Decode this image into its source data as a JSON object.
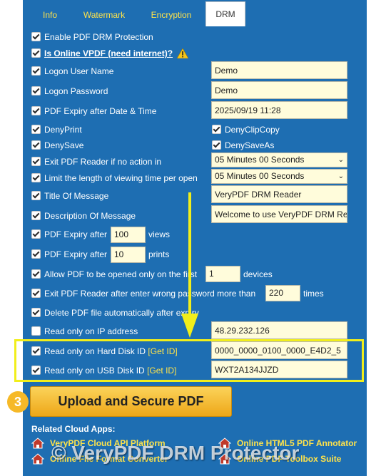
{
  "tabs": [
    {
      "label": "Info"
    },
    {
      "label": "Watermark"
    },
    {
      "label": "Encryption"
    },
    {
      "label": "DRM"
    }
  ],
  "rows": {
    "enable_drm": "Enable PDF DRM Protection",
    "online_vpdf": "Is Online VPDF (need internet)?",
    "logon_user": "Logon User Name",
    "logon_password": "Logon Password",
    "expiry_date": "PDF Expiry after Date & Time",
    "deny_print": "DenyPrint",
    "deny_clip": "DenyClipCopy",
    "deny_save": "DenySave",
    "deny_saveas": "DenySaveAs",
    "exit_no_action": "Exit PDF Reader if no action in",
    "limit_view": "Limit the length of viewing time per open",
    "title_msg": "Title Of Message",
    "desc_msg": "Description Of Message",
    "expiry_after": "PDF Expiry after",
    "views": "views",
    "expiry_prints": "PDF Expiry after",
    "prints": "prints",
    "allow_first": "Allow PDF to be opened only on the first",
    "devices": "devices",
    "exit_wrong_pw": "Exit PDF Reader after enter wrong password more than",
    "times": "times",
    "delete_after": "Delete PDF file automatically after expiry",
    "ip_only": "Read only on IP address",
    "hdd_only": "Read only on Hard Disk ID",
    "usb_only": "Read only on USB Disk ID",
    "get_id": "[Get ID]"
  },
  "fields": {
    "user": "Demo",
    "password": "Demo",
    "expiry_date": "2025/09/19 11:28",
    "exit_no_action": "05 Minutes 00 Seconds",
    "limit_view": "05 Minutes 00 Seconds",
    "title_msg": "VeryPDF DRM Reader",
    "desc_msg": "Welcome to use VeryPDF DRM Re",
    "views": "100",
    "prints": "10",
    "devices": "1",
    "wrong_pw": "220",
    "ip": "48.29.232.126",
    "hdd": "0000_0000_0100_0000_E4D2_5",
    "usb": "WXT2A134JJZD"
  },
  "checkbox_states": {
    "enable_drm": true,
    "online_vpdf": true,
    "logon_user": true,
    "logon_password": true,
    "expiry_date": true,
    "deny_print": true,
    "deny_clip": true,
    "deny_save": true,
    "deny_saveas": true,
    "exit_no_action": true,
    "limit_view": true,
    "title_msg": true,
    "desc_msg": true,
    "expiry_after": true,
    "expiry_prints": true,
    "allow_first": true,
    "exit_wrong_pw": true,
    "delete_after": true,
    "ip_only": false,
    "hdd_only": true,
    "usb_only": true
  },
  "step_number": "3",
  "upload_label": "Upload and Secure PDF",
  "related_label": "Related Cloud Apps:",
  "apps": [
    {
      "label": "VeryPDF Cloud API Platform"
    },
    {
      "label": "Online HTML5 PDF Annotator"
    },
    {
      "label": "Online File Format Converter"
    },
    {
      "label": "Online PDF Toolbox Suite"
    }
  ],
  "watermark": "© VeryPDF DRM Protector",
  "icons": {
    "warning": "warning-icon",
    "house": "house-icon",
    "arrow": "down-arrow-annotation"
  },
  "colors": {
    "panel": "#1e6eb2",
    "tab_text": "#ffe34a",
    "input_bg": "#fffcdb",
    "highlight": "#f1ee1b",
    "button": "#f4bc2c"
  }
}
